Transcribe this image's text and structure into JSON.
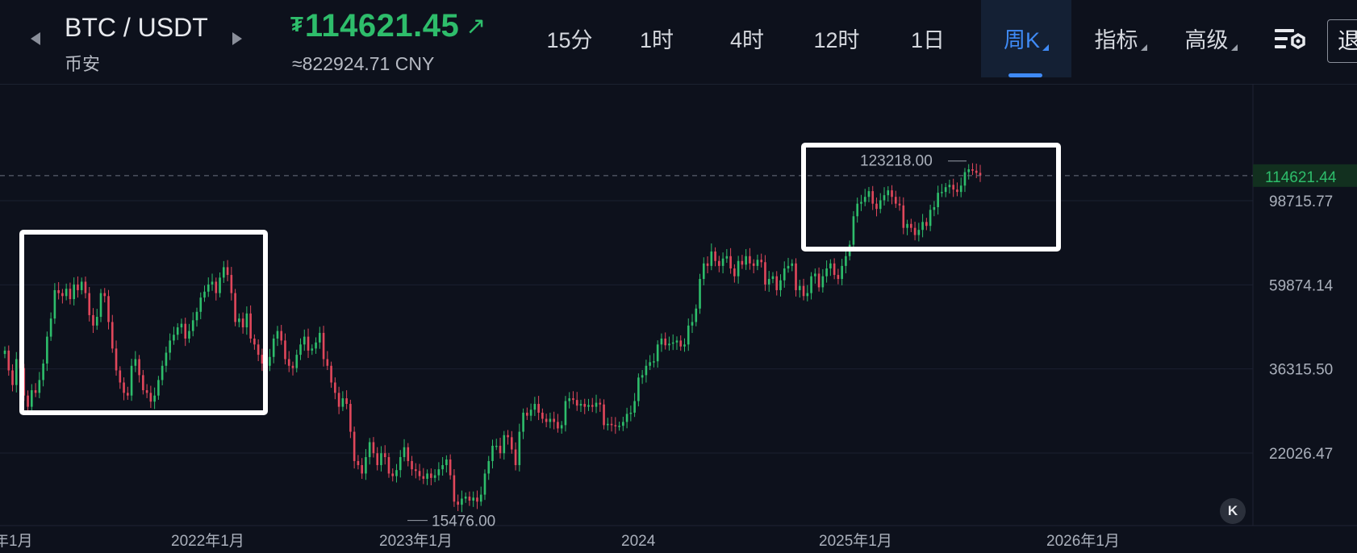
{
  "header": {
    "pair": "BTC / USDT",
    "exchange": "币安",
    "price_currency_symbol": "₮",
    "price": "114621.45",
    "price_trend_icon": "arrow-up-right-icon",
    "cny_price": "≈822924.71 CNY",
    "up_color": "#2ebd6b",
    "down_color": "#e0475b",
    "accent_color": "#3f8af5"
  },
  "tabs": [
    {
      "label": "15分",
      "active": false,
      "dropdown": false
    },
    {
      "label": "1时",
      "active": false,
      "dropdown": false
    },
    {
      "label": "4时",
      "active": false,
      "dropdown": false
    },
    {
      "label": "12时",
      "active": false,
      "dropdown": false
    },
    {
      "label": "1日",
      "active": false,
      "dropdown": false
    },
    {
      "label": "周K",
      "active": true,
      "dropdown": true
    },
    {
      "label": "指标",
      "active": false,
      "dropdown": true
    },
    {
      "label": "高级",
      "active": false,
      "dropdown": true
    }
  ],
  "toolbar": {
    "settings_icon": "chart-settings-icon",
    "exit_label": "退"
  },
  "chart": {
    "y_axis_labels": [
      "98715.77",
      "59874.14",
      "36315.50",
      "22026.47"
    ],
    "x_axis_labels": [
      "年1月",
      "2022年1月",
      "2023年1月",
      "2024",
      "2025年1月",
      "2026年1月"
    ],
    "current_price_label": "114621.44",
    "high_label": "123218.00",
    "low_label": "15476.00",
    "collapse_label": "K"
  },
  "chart_data": {
    "type": "candlestick",
    "interval": "weekly",
    "y_scale": "log",
    "ylim": [
      12000,
      160000
    ],
    "y_ticks": [
      98715.77,
      59874.14,
      36315.5,
      22026.47
    ],
    "x_ticks": [
      "年1月",
      "2022年1月",
      "2023年1月",
      "2024",
      "2025年1月",
      "2026年1月"
    ],
    "current_price": 114621.44,
    "high": 123218.0,
    "low": 15476.0,
    "weekly_closes": [
      40500,
      36000,
      33000,
      38500,
      36500,
      31000,
      29000,
      32000,
      31500,
      34000,
      37500,
      44000,
      49000,
      58000,
      57000,
      56000,
      58500,
      55000,
      60000,
      58000,
      61000,
      57000,
      50000,
      47000,
      49500,
      57000,
      56000,
      48000,
      41000,
      36000,
      33500,
      31500,
      31000,
      37000,
      38500,
      35000,
      32000,
      31500,
      29900,
      31000,
      34000,
      37000,
      40000,
      43000,
      44500,
      46500,
      47500,
      43500,
      45500,
      48500,
      51000,
      55500,
      57500,
      60000,
      61000,
      57000,
      62500,
      66500,
      63500,
      57000,
      48000,
      49000,
      46500,
      50500,
      43500,
      42000,
      39500,
      37500,
      37000,
      39000,
      43500,
      45500,
      43000,
      38500,
      37000,
      36500,
      39500,
      42000,
      44000,
      40500,
      41000,
      42500,
      45000,
      38500,
      37000,
      33500,
      31500,
      29000,
      30500,
      29500,
      25000,
      21000,
      20500,
      19500,
      21500,
      23500,
      22000,
      20500,
      22000,
      21500,
      19500,
      19200,
      19900,
      21500,
      22800,
      21000,
      20000,
      19800,
      19200,
      18900,
      19500,
      19000,
      19300,
      20000,
      20500,
      21200,
      19300,
      16500,
      16200,
      16800,
      17000,
      16600,
      16900,
      16500,
      17200,
      19500,
      21000,
      23000,
      23000,
      22000,
      24500,
      24200,
      22500,
      20500,
      25000,
      28000,
      27500,
      28500,
      29500,
      28000,
      27000,
      26500,
      27000,
      26500,
      25500,
      26000,
      30000,
      30500,
      30200,
      29200,
      29500,
      29000,
      29300,
      29000,
      29700,
      29400,
      26000,
      26200,
      26000,
      25800,
      25900,
      26500,
      27800,
      28000,
      30000,
      34500,
      35000,
      37000,
      37800,
      38000,
      42000,
      43500,
      41800,
      42200,
      42500,
      43000,
      41500,
      42000,
      47000,
      48000,
      52000,
      62000,
      68000,
      67000,
      73000,
      69000,
      67000,
      70000,
      71000,
      66000,
      63000,
      69000,
      67500,
      71000,
      68000,
      67000,
      69500,
      68500,
      60000,
      62000,
      63000,
      58000,
      61500,
      66000,
      67000,
      68000,
      58000,
      59500,
      56000,
      57000,
      63000,
      64000,
      59000,
      63000,
      66000,
      68000,
      63500,
      62000,
      67000,
      71000,
      76000,
      90000,
      97000,
      98000,
      101000,
      104500,
      97000,
      94000,
      99000,
      102000,
      105000,
      101000,
      97000,
      96000,
      84000,
      86000,
      84000,
      80500,
      83000,
      87000,
      85000,
      93500,
      95000,
      103500,
      104000,
      107000,
      108500,
      105500,
      104000,
      108000,
      117000,
      119000,
      118000,
      116500,
      114621
    ]
  }
}
